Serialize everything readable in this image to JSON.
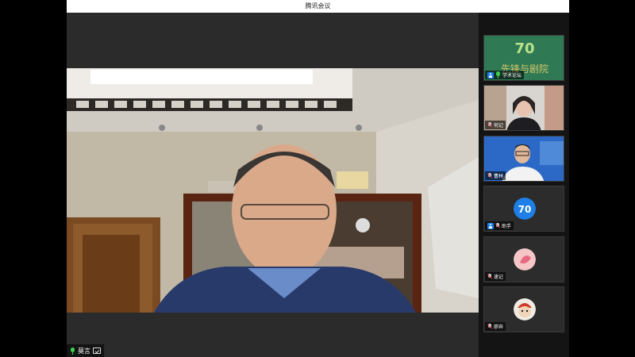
{
  "window": {
    "title": "腾讯会议"
  },
  "main_speaker": {
    "name": "莫言"
  },
  "participants": [
    {
      "name": "学术论坛",
      "thumb_text": "70",
      "thumb_subtext": "先锋与剧院",
      "pinned": true,
      "muted": false,
      "type": "logo-video"
    },
    {
      "name": "何记",
      "pinned": false,
      "muted": true,
      "type": "video-woman"
    },
    {
      "name": "曹林",
      "pinned": false,
      "muted": true,
      "type": "video-man"
    },
    {
      "name": "助手",
      "thumb_text": "70",
      "pinned": true,
      "muted": true,
      "type": "avatar-70"
    },
    {
      "name": "速记",
      "pinned": false,
      "muted": true,
      "type": "avatar-pink"
    },
    {
      "name": "廖奔",
      "pinned": false,
      "muted": true,
      "type": "avatar-cartoon"
    }
  ],
  "colors": {
    "accent_blue": "#1e7fe8",
    "mic_green": "#3ccf4e"
  }
}
